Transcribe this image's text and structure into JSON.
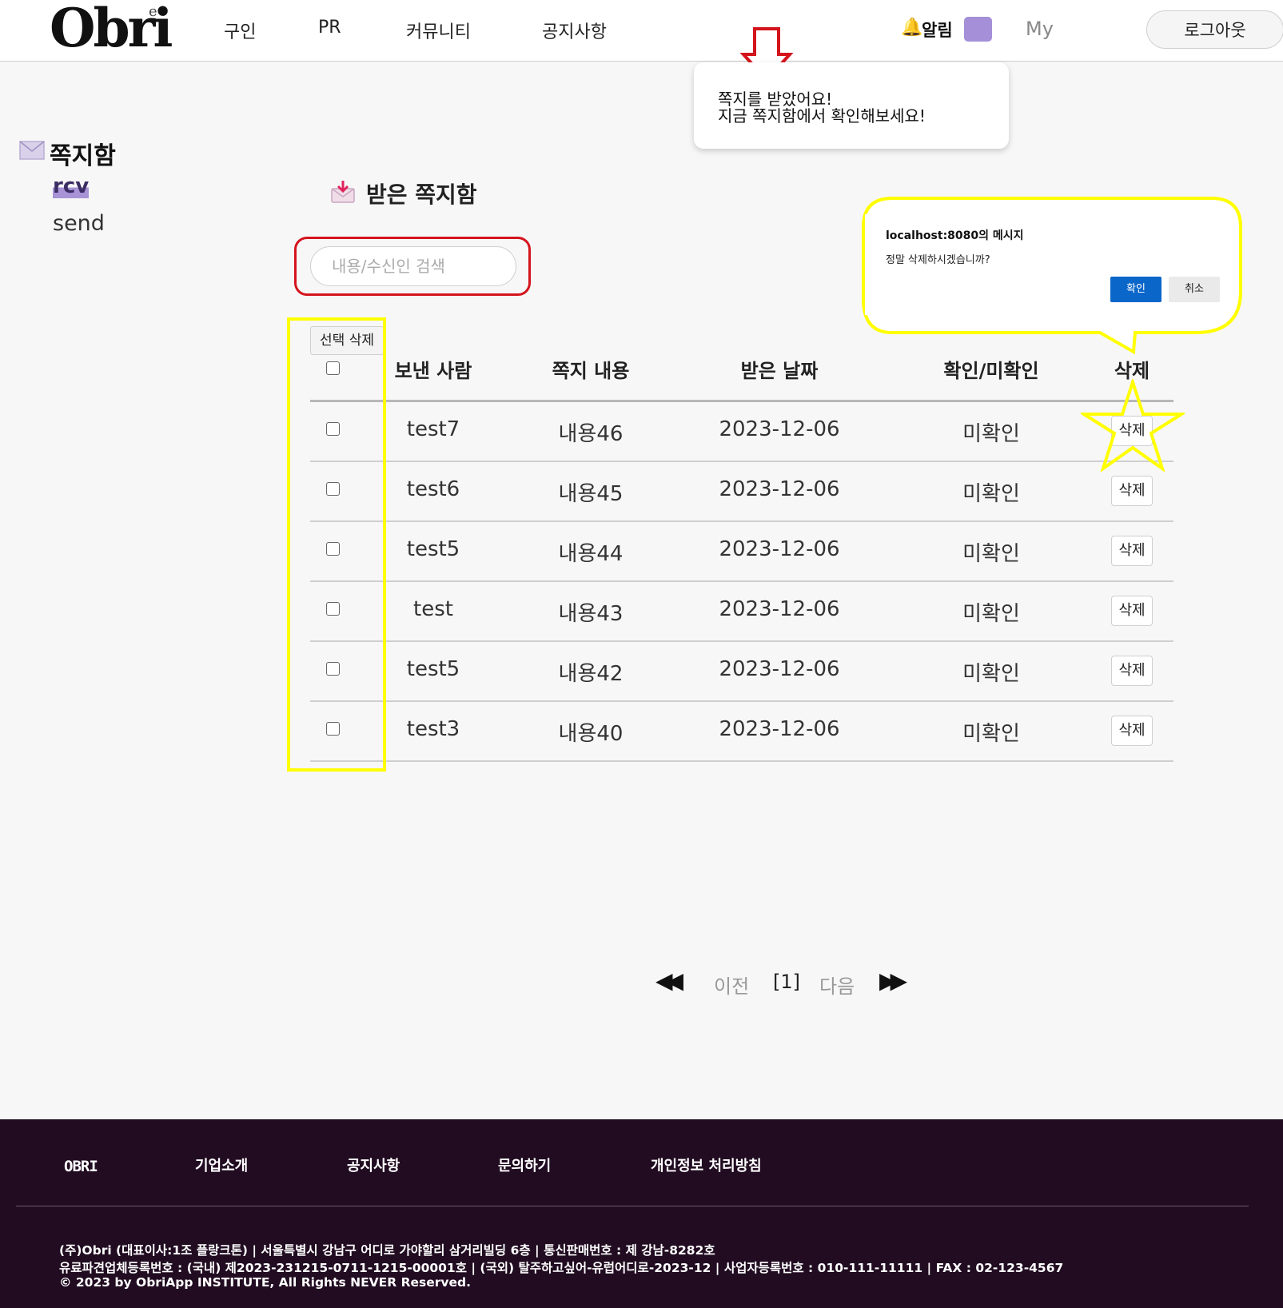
{
  "header": {
    "logo": "Obri",
    "logo_sup": "e",
    "nav": [
      "구인",
      "PR",
      "커뮤니티",
      "공지사항"
    ],
    "notification_label": "알림",
    "my_label": "My",
    "logout_label": "로그아웃"
  },
  "popup": {
    "message": "쪽지를 받았어요!\n지금 쪽지함에서 확인해보세요!"
  },
  "sidebar": {
    "title": "쪽지함",
    "items": [
      "rcv",
      "send"
    ]
  },
  "main": {
    "title": "받은 쪽지함",
    "search_placeholder": "내용/수신인 검색",
    "select_delete_label": "선택 삭제",
    "columns": [
      "보낸 사람",
      "쪽지 내용",
      "받은 날짜",
      "확인/미확인",
      "삭제"
    ],
    "delete_button_label": "삭제",
    "rows": [
      {
        "sender": "test7",
        "content": "내용46",
        "date": "2023-12-06",
        "status": "미확인"
      },
      {
        "sender": "test6",
        "content": "내용45",
        "date": "2023-12-06",
        "status": "미확인"
      },
      {
        "sender": "test5",
        "content": "내용44",
        "date": "2023-12-06",
        "status": "미확인"
      },
      {
        "sender": "test",
        "content": "내용43",
        "date": "2023-12-06",
        "status": "미확인"
      },
      {
        "sender": "test5",
        "content": "내용42",
        "date": "2023-12-06",
        "status": "미확인"
      },
      {
        "sender": "test3",
        "content": "내용40",
        "date": "2023-12-06",
        "status": "미확인"
      }
    ]
  },
  "dialog": {
    "title": "localhost:8080의 메시지",
    "message": "정말 삭제하시겠습니까?",
    "ok_label": "확인",
    "cancel_label": "취소"
  },
  "pagination": {
    "first": "◀◀",
    "prev": "이전",
    "current": "[1]",
    "next": "다음",
    "last": "▶▶"
  },
  "footer": {
    "logo": "OBRI",
    "links": [
      "기업소개",
      "공지사항",
      "문의하기",
      "개인정보 처리방침"
    ],
    "info": [
      "(주)Obri (대표이사:1조 플랑크톤) | 서울특별시 강남구 어디로 가야할리 삼거리빌딩 6층 | 통신판매번호 : 제 강남-8282호",
      "유료파견업체등록번호 : (국내) 제2023-231215-0711-1215-00001호 | (국외) 탈주하고싶어-유럽어디로-2023-12 | 사업자등록번호 : 010-111-11111 | FAX : 02-123-4567",
      "© 2023 by ObriApp INSTITUTE, All Rights NEVER Reserved."
    ]
  },
  "colors": {
    "accent_purple": "#a48fd8",
    "footer_bg": "#210c21",
    "dialog_ok": "#0a66c8",
    "annotation_red": "#d4141c",
    "annotation_yellow": "#ffff00"
  }
}
